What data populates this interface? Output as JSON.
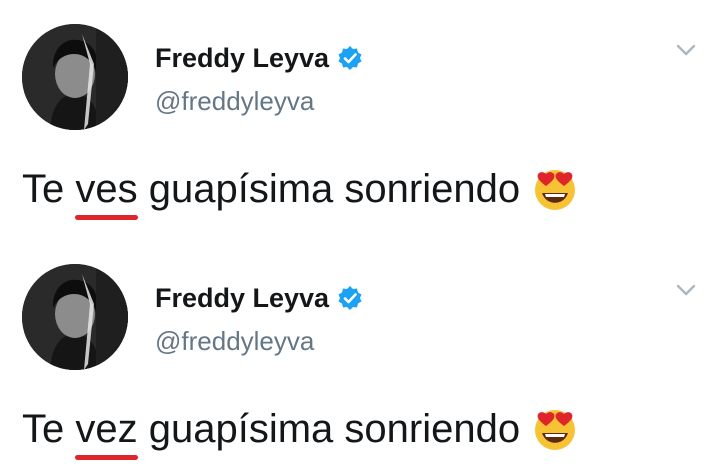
{
  "tweets": [
    {
      "display_name": "Freddy Leyva",
      "handle": "@freddyleyva",
      "text_before": "Te ",
      "marked_word": "ves",
      "text_after": " guapísima sonriendo",
      "emoji": "smiling-face-with-heart-eyes",
      "marked_word_underline_color": "#e0242c"
    },
    {
      "display_name": "Freddy Leyva",
      "handle": "@freddyleyva",
      "text_before": "Te ",
      "marked_word": "vez",
      "text_after": " guapísima sonriendo",
      "emoji": "smiling-face-with-heart-eyes",
      "marked_word_underline_color": "#e0242c"
    }
  ],
  "colors": {
    "verified_badge": "#1da1f2",
    "handle_text": "#657786",
    "chevron": "#aab8c2"
  }
}
